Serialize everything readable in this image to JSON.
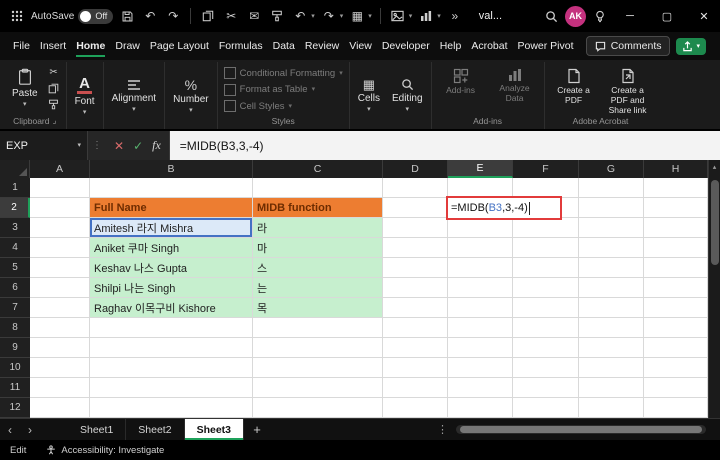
{
  "titlebar": {
    "autosave_label": "AutoSave",
    "autosave_state": "Off",
    "filename": "val...",
    "avatar_initials": "AK"
  },
  "menubar": {
    "items": [
      "File",
      "Insert",
      "Home",
      "Draw",
      "Page Layout",
      "Formulas",
      "Data",
      "Review",
      "View",
      "Developer",
      "Help",
      "Acrobat",
      "Power Pivot"
    ],
    "active_item": "Home",
    "comments_label": "Comments"
  },
  "ribbon": {
    "paste": "Paste",
    "font": "Font",
    "alignment": "Alignment",
    "number": "Number",
    "styles": [
      "Conditional Formatting",
      "Format as Table",
      "Cell Styles"
    ],
    "cells": "Cells",
    "editing": "Editing",
    "addins": "Add-ins",
    "analyze": "Analyze Data",
    "create_pdf": "Create a PDF",
    "create_pdf_share": "Create a PDF and Share link",
    "groups": {
      "clipboard": "Clipboard",
      "styles": "Styles",
      "addins": "Add-ins",
      "acrobat": "Adobe Acrobat"
    }
  },
  "formula_bar": {
    "name_box": "EXP",
    "fx": "fx",
    "formula": "=MIDB(B3,3,-4)"
  },
  "grid": {
    "columns": [
      "A",
      "B",
      "C",
      "D",
      "E",
      "F",
      "G",
      "H"
    ],
    "rows": [
      "1",
      "2",
      "3",
      "4",
      "5",
      "6",
      "7",
      "8",
      "9",
      "10",
      "11",
      "12"
    ],
    "active_column": "E",
    "active_row": "2"
  },
  "table": {
    "name_header": "Full Name",
    "func_header": "MIDB function",
    "rows": [
      {
        "name": "Amitesh 라지 Mishra",
        "result": "라"
      },
      {
        "name": "Aniket 쿠마 Singh",
        "result": "마"
      },
      {
        "name": "Keshav 나스 Gupta",
        "result": "스"
      },
      {
        "name": "Shilpi 나는 Singh",
        "result": "는"
      },
      {
        "name": "Raghav 이목구비 Kishore",
        "result": "목"
      }
    ]
  },
  "cell_editor": {
    "prefix": "=MIDB(",
    "ref": "B3",
    "suffix": ",3,-4)"
  },
  "sheet_bar": {
    "tabs": [
      "Sheet1",
      "Sheet2",
      "Sheet3"
    ],
    "active_tab": "Sheet3"
  },
  "status_bar": {
    "mode": "Edit",
    "accessibility": "Accessibility: Investigate"
  },
  "icons": {
    "undo": "↶",
    "redo": "↷",
    "cut": "✂",
    "mail": "✉",
    "caret": "▾",
    "overflow": "»",
    "table_glyph": "▦",
    "percent": "%",
    "font_glyph": "A",
    "chevron_left": "‹",
    "chevron_right": "›",
    "plus": "+",
    "kebab": "⋮",
    "minimize": "─",
    "maximize": "▢",
    "close": "✕",
    "dialog_launcher": "⌟",
    "up_arrow": "▲"
  },
  "colors": {
    "accent_green": "#1EA15A",
    "header_fill": "#ED7D31",
    "header_text": "#6E2C00",
    "data_fill": "#C6EFCE",
    "ref_fill": "#DCE9F8",
    "ref_border": "#4472C4",
    "annotation_red": "#E23B3B",
    "avatar_pink": "#C4317E"
  }
}
